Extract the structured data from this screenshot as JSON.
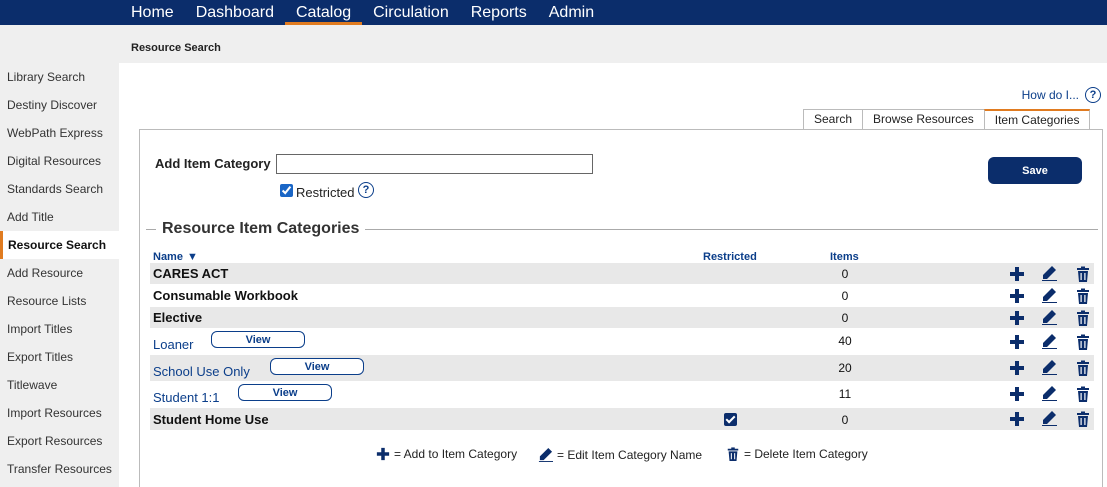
{
  "nav": {
    "items": [
      {
        "label": "Home",
        "active": false
      },
      {
        "label": "Dashboard",
        "active": false
      },
      {
        "label": "Catalog",
        "active": true
      },
      {
        "label": "Circulation",
        "active": false
      },
      {
        "label": "Reports",
        "active": false
      },
      {
        "label": "Admin",
        "active": false
      }
    ]
  },
  "breadcrumb": "Resource Search",
  "sidebar": {
    "items": [
      {
        "label": "Library Search"
      },
      {
        "label": "Destiny Discover"
      },
      {
        "label": "WebPath Express"
      },
      {
        "label": "Digital Resources"
      },
      {
        "label": "Standards Search"
      },
      {
        "label": "Add Title"
      },
      {
        "label": "Resource Search",
        "active": true
      },
      {
        "label": "Add Resource"
      },
      {
        "label": "Resource Lists"
      },
      {
        "label": "Import Titles"
      },
      {
        "label": "Export Titles"
      },
      {
        "label": "Titlewave"
      },
      {
        "label": "Import Resources"
      },
      {
        "label": "Export Resources"
      },
      {
        "label": "Transfer Resources"
      }
    ]
  },
  "help": {
    "label": "How do I...",
    "icon": "question-circle-icon"
  },
  "tabs": [
    {
      "label": "Search",
      "active": false
    },
    {
      "label": "Browse Resources",
      "active": false
    },
    {
      "label": "Item Categories",
      "active": true
    }
  ],
  "form": {
    "add_label": "Add Item Category",
    "input_value": "",
    "restricted_label": "Restricted",
    "restricted_checked": true,
    "save_label": "Save"
  },
  "section_title": "Resource Item Categories",
  "table": {
    "headers": {
      "name": "Name",
      "restricted": "Restricted",
      "items": "Items"
    },
    "rows": [
      {
        "name": "CARES ACT",
        "link": false,
        "view": false,
        "restricted": false,
        "items": "0"
      },
      {
        "name": "Consumable Workbook",
        "link": false,
        "view": false,
        "restricted": false,
        "items": "0"
      },
      {
        "name": "Elective",
        "link": false,
        "view": false,
        "restricted": false,
        "items": "0"
      },
      {
        "name": "Loaner",
        "link": true,
        "view": true,
        "restricted": false,
        "items": "40"
      },
      {
        "name": "School Use Only",
        "link": true,
        "view": true,
        "restricted": false,
        "items": "20"
      },
      {
        "name": "Student 1:1",
        "link": true,
        "view": true,
        "restricted": false,
        "items": "11"
      },
      {
        "name": "Student Home Use",
        "link": false,
        "view": false,
        "restricted": true,
        "items": "0"
      }
    ],
    "view_label": "View"
  },
  "legend": {
    "add": "= Add to Item Category",
    "edit": "= Edit Item Category Name",
    "delete": "= Delete Item Category"
  },
  "colors": {
    "nav_bg": "#0b2d6b",
    "accent": "#e07b20",
    "link": "#0b3e8a"
  }
}
